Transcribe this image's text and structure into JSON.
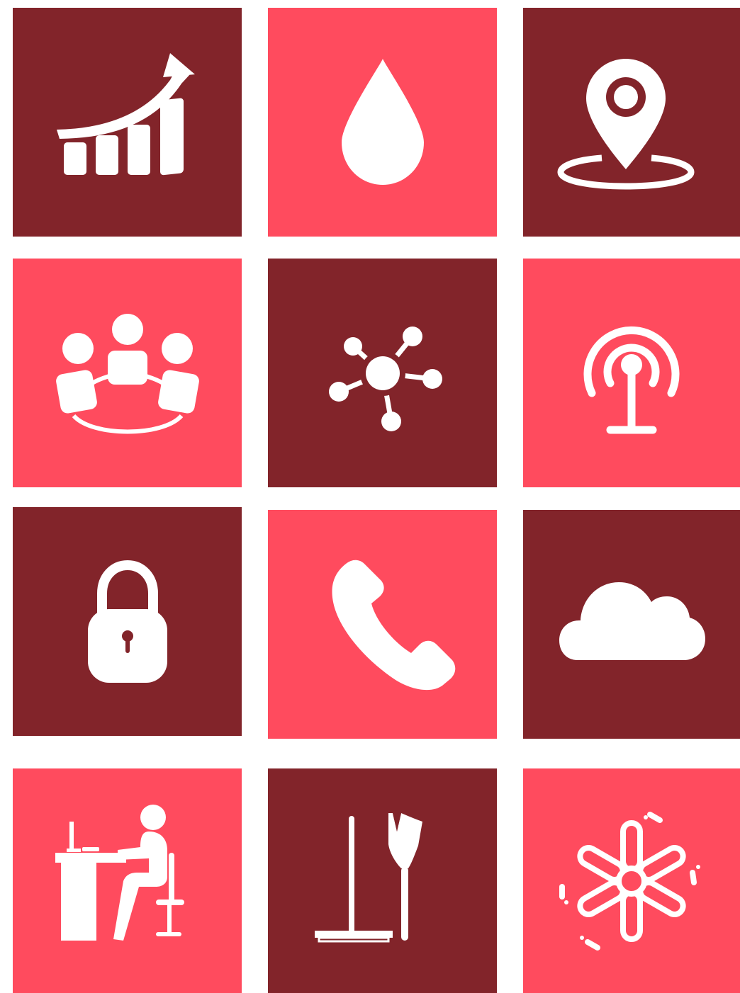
{
  "colors": {
    "dark": "#82242a",
    "light": "#ff4b5e",
    "icon": "#ffffff",
    "background": "#ffffff"
  },
  "tiles": [
    {
      "icon": "growth-chart-icon",
      "color": "dark"
    },
    {
      "icon": "water-drop-icon",
      "color": "light"
    },
    {
      "icon": "location-pin-icon",
      "color": "dark"
    },
    {
      "icon": "team-meeting-icon",
      "color": "light"
    },
    {
      "icon": "network-molecule-icon",
      "color": "dark"
    },
    {
      "icon": "broadcast-signal-icon",
      "color": "light"
    },
    {
      "icon": "padlock-icon",
      "color": "dark"
    },
    {
      "icon": "phone-icon",
      "color": "light"
    },
    {
      "icon": "cloud-icon",
      "color": "dark"
    },
    {
      "icon": "person-at-desk-icon",
      "color": "light"
    },
    {
      "icon": "floor-squeegee-icon",
      "color": "dark"
    },
    {
      "icon": "ceiling-fan-icon",
      "color": "light"
    }
  ]
}
